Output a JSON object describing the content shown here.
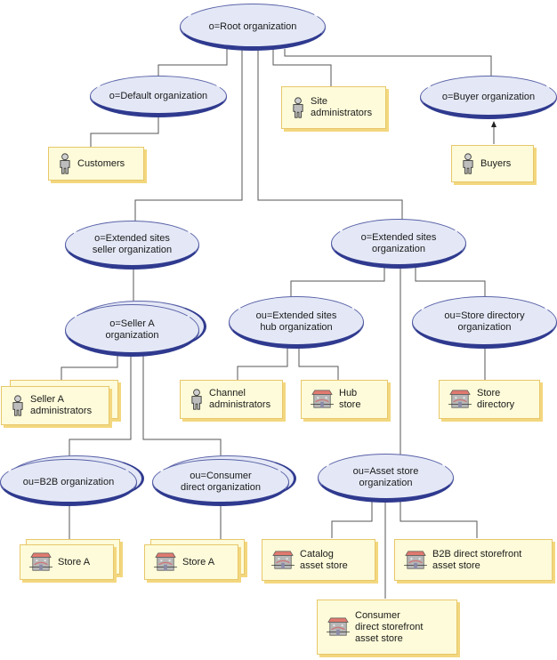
{
  "diagram": {
    "organizations": {
      "root": "o=Root organization",
      "default": "o=Default organization",
      "buyer": "o=Buyer organization",
      "ext_seller": "o=Extended sites\nseller organization",
      "ext_sites": "o=Extended sites\norganization",
      "seller_a": "o=Seller A\norganization",
      "hub": "ou=Extended sites\nhub organization",
      "store_dir": "ou=Store directory\norganization",
      "b2b": "ou=B2B organization",
      "consumer": "ou=Consumer\ndirect organization",
      "asset": "ou=Asset store\norganization"
    },
    "entities": {
      "customers": {
        "label": "Customers",
        "icon": "person-icon"
      },
      "site_admins": {
        "label": "Site\nadministrators",
        "icon": "person-icon"
      },
      "buyers": {
        "label": "Buyers",
        "icon": "person-icon"
      },
      "seller_admins": {
        "label": "Seller A\nadministrators",
        "icon": "person-icon"
      },
      "channel_admins": {
        "label": "Channel\nadministrators",
        "icon": "person-icon"
      },
      "hub_store": {
        "label": "Hub\nstore",
        "icon": "store-icon"
      },
      "store_directory": {
        "label": "Store\ndirectory",
        "icon": "store-icon"
      },
      "store_a_b2b": {
        "label": "Store A",
        "icon": "store-icon"
      },
      "store_a_consumer": {
        "label": "Store A",
        "icon": "store-icon"
      },
      "catalog_asset": {
        "label": "Catalog\nasset store",
        "icon": "store-icon"
      },
      "b2b_asset": {
        "label": "B2B direct storefront\nasset store",
        "icon": "store-icon"
      },
      "consumer_asset": {
        "label": "Consumer\ndirect storefront\nasset store",
        "icon": "store-icon"
      }
    },
    "colors": {
      "org_fill": "#e4e8f6",
      "org_edge": "#2f3a8f",
      "box_fill": "#fdfbd9",
      "box_edge": "#f3d77e",
      "connector": "#555555"
    }
  }
}
